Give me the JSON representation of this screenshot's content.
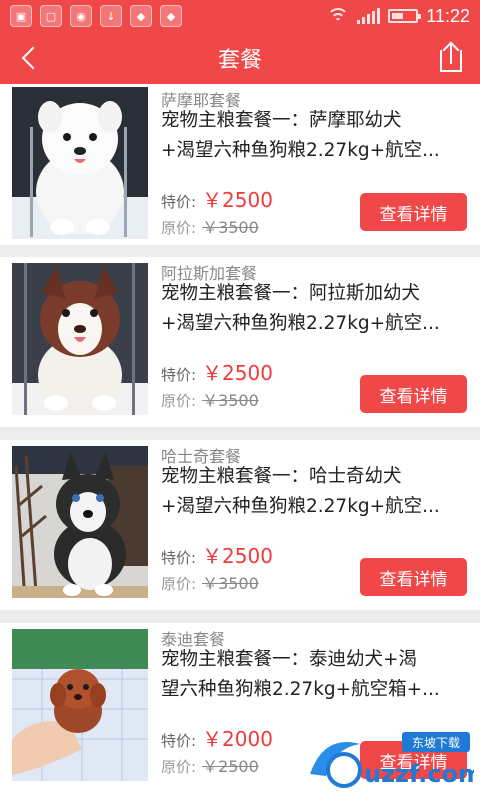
{
  "status_bar": {
    "time": "11:22",
    "left_icons": [
      "image-icon",
      "lock-icon",
      "iflyer-icon",
      "download-icon",
      "shield-icon",
      "shield-badge-icon"
    ],
    "right_icons": [
      "wifi-icon",
      "signal-icon",
      "battery-icon"
    ]
  },
  "header": {
    "title": "套餐",
    "back_icon": "chevron-left-icon",
    "share_icon": "share-icon"
  },
  "packages": [
    {
      "category": "萨摩耶套餐",
      "line1": "宠物主粮套餐一：萨摩耶幼犬",
      "line2": "+渴望六种鱼狗粮2.27kg+航空...",
      "sale_label": "特价:",
      "sale_price": "￥2500",
      "orig_label": "原价:",
      "orig_price": "￥3500",
      "button": "查看详情"
    },
    {
      "category": "阿拉斯加套餐",
      "line1": "宠物主粮套餐一：阿拉斯加幼犬",
      "line2": "+渴望六种鱼狗粮2.27kg+航空...",
      "sale_label": "特价:",
      "sale_price": "￥2500",
      "orig_label": "原价:",
      "orig_price": "￥3500",
      "button": "查看详情"
    },
    {
      "category": "哈士奇套餐",
      "line1": "宠物主粮套餐一：哈士奇幼犬",
      "line2": "+渴望六种鱼狗粮2.27kg+航空...",
      "sale_label": "特价:",
      "sale_price": "￥2500",
      "orig_label": "原价:",
      "orig_price": "￥3500",
      "button": "查看详情"
    },
    {
      "category": "泰迪套餐",
      "line1": "宠物主粮套餐一：泰迪幼犬+渴",
      "line2": "望六种鱼狗粮2.27kg+航空箱+...",
      "sale_label": "特价:",
      "sale_price": "￥2000",
      "orig_label": "原价:",
      "orig_price": "￥2500",
      "button": "查看详情"
    }
  ],
  "watermark": {
    "text": "uzzf.com",
    "badge": "东坡下载"
  },
  "colors": {
    "accent": "#f04848",
    "price": "#ee3b3b",
    "background": "#ececec"
  }
}
